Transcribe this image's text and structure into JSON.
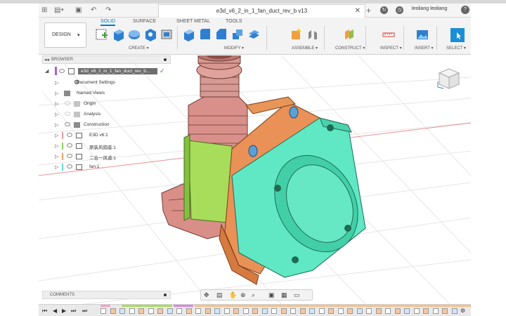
{
  "window": {
    "title": "e3d_v6_2_in_1_fan_duct_rev_b v13"
  },
  "quick_access": {
    "grid_icon": "grid-icon",
    "file_icon": "file-icon",
    "save_icon": "save-icon",
    "undo_icon": "undo-icon",
    "redo_icon": "redo-icon"
  },
  "user": {
    "name": "leoliang leoliang"
  },
  "ribbon": {
    "workspace_label": "DESIGN",
    "tabs": [
      {
        "label": "SOLID",
        "active": true
      },
      {
        "label": "SURFACE"
      },
      {
        "label": "SHEET METAL"
      },
      {
        "label": "TOOLS"
      }
    ],
    "groups": [
      {
        "label": "CREATE"
      },
      {
        "label": "MODIFY"
      },
      {
        "label": "ASSEMBLE"
      },
      {
        "label": "CONSTRUCT"
      },
      {
        "label": "INSPECT"
      },
      {
        "label": "INSERT"
      },
      {
        "label": "SELECT"
      }
    ]
  },
  "browser": {
    "header": "BROWSER",
    "root": "e3d_v6_2_in_1_fan_duct_rev_b...",
    "nodes": [
      {
        "label": "Document Settings",
        "icon": "gear-icon"
      },
      {
        "label": "Named Views",
        "icon": "folder-icon"
      },
      {
        "label": "Origin",
        "icon": "folder-icon"
      },
      {
        "label": "Analysis",
        "icon": "folder-icon"
      },
      {
        "label": "Construction",
        "icon": "folder-icon"
      },
      {
        "label": "E3D v6:1",
        "icon": "component-icon",
        "color": "#e89aa0"
      },
      {
        "label": "原装风扇座:1",
        "icon": "component-icon",
        "color": "#8fd46a"
      },
      {
        "label": "二合一风道:1",
        "icon": "component-icon",
        "color": "#f0a060"
      },
      {
        "label": "fan:1",
        "icon": "component-icon",
        "color": "#5fe0c8"
      }
    ]
  },
  "comments": {
    "header": "COMMENTS"
  },
  "colors": {
    "accent": "#0a7ab8",
    "heater_block": "#d98a84",
    "fan_duct": "#e8955a",
    "fan_mount": "#9ddc5a",
    "fan": "#4ee3c0"
  }
}
